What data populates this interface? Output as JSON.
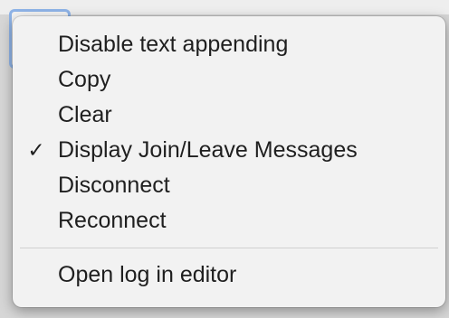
{
  "context_menu": {
    "items": [
      {
        "label": "Disable text appending",
        "checked": false
      },
      {
        "label": "Copy",
        "checked": false
      },
      {
        "label": "Clear",
        "checked": false
      },
      {
        "label": "Display Join/Leave Messages",
        "checked": true,
        "check_glyph": "✓"
      },
      {
        "label": "Disconnect",
        "checked": false
      },
      {
        "label": "Reconnect",
        "checked": false
      }
    ],
    "footer_items": [
      {
        "label": "Open log in editor"
      }
    ]
  },
  "icons": {
    "checkmark": "checkmark-icon"
  },
  "colors": {
    "menu_background": "#f2f2f2",
    "text": "#1f1f1f",
    "focus_ring": "#8fb4e8",
    "separator": "#d0d0d0"
  }
}
